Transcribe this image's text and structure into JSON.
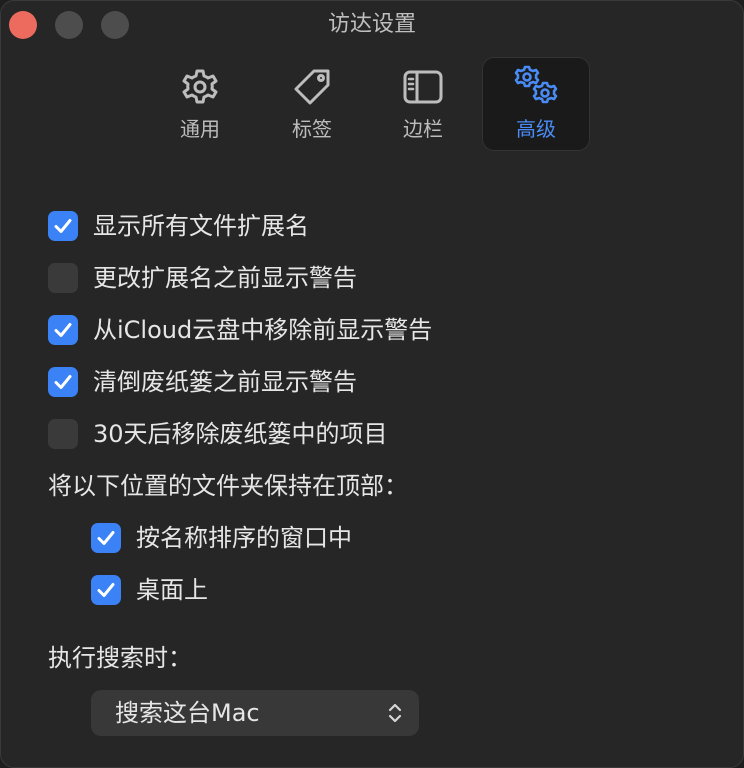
{
  "window": {
    "title": "访达设置"
  },
  "toolbar": {
    "tabs": [
      {
        "label": "通用",
        "icon": "gear-icon"
      },
      {
        "label": "标签",
        "icon": "tag-icon"
      },
      {
        "label": "边栏",
        "icon": "sidebar-icon"
      },
      {
        "label": "高级",
        "icon": "gears-icon",
        "selected": true
      }
    ]
  },
  "options": [
    {
      "label": "显示所有文件扩展名",
      "checked": true
    },
    {
      "label": "更改扩展名之前显示警告",
      "checked": false
    },
    {
      "label": "从iCloud云盘中移除前显示警告",
      "checked": true
    },
    {
      "label": "清倒废纸篓之前显示警告",
      "checked": true
    },
    {
      "label": "30天后移除废纸篓中的项目",
      "checked": false
    }
  ],
  "keep_folders": {
    "heading": "将以下位置的文件夹保持在顶部：",
    "items": [
      {
        "label": "按名称排序的窗口中",
        "checked": true
      },
      {
        "label": "桌面上",
        "checked": true
      }
    ]
  },
  "search": {
    "heading": "执行搜索时：",
    "selected": "搜索这台Mac"
  },
  "colors": {
    "accent": "#3b82f6",
    "close_button": "#ed6a5e"
  }
}
